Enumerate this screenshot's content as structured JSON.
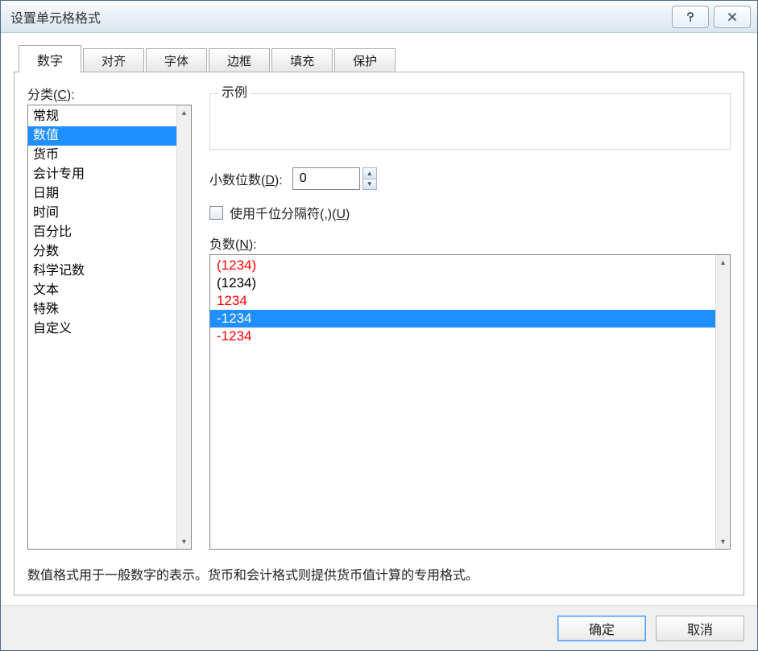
{
  "window": {
    "title": "设置单元格格式"
  },
  "tabs": [
    {
      "label": "数字",
      "active": true
    },
    {
      "label": "对齐",
      "active": false
    },
    {
      "label": "字体",
      "active": false
    },
    {
      "label": "边框",
      "active": false
    },
    {
      "label": "填充",
      "active": false
    },
    {
      "label": "保护",
      "active": false
    }
  ],
  "category": {
    "label_prefix": "分类(",
    "label_hotkey": "C",
    "label_suffix": "):",
    "items": [
      {
        "label": "常规",
        "selected": false
      },
      {
        "label": "数值",
        "selected": true
      },
      {
        "label": "货币",
        "selected": false
      },
      {
        "label": "会计专用",
        "selected": false
      },
      {
        "label": "日期",
        "selected": false
      },
      {
        "label": "时间",
        "selected": false
      },
      {
        "label": "百分比",
        "selected": false
      },
      {
        "label": "分数",
        "selected": false
      },
      {
        "label": "科学记数",
        "selected": false
      },
      {
        "label": "文本",
        "selected": false
      },
      {
        "label": "特殊",
        "selected": false
      },
      {
        "label": "自定义",
        "selected": false
      }
    ]
  },
  "example": {
    "legend": "示例",
    "value": ""
  },
  "decimal": {
    "label_prefix": "小数位数(",
    "label_hotkey": "D",
    "label_suffix": "):",
    "value": "0"
  },
  "thousands": {
    "label_prefix": "使用千位分隔符(,)(",
    "label_hotkey": "U",
    "label_suffix": ")",
    "checked": false
  },
  "negative": {
    "label_prefix": "负数(",
    "label_hotkey": "N",
    "label_suffix": "):",
    "items": [
      {
        "text": "(1234)",
        "color": "red",
        "selected": false
      },
      {
        "text": "(1234)",
        "color": "black",
        "selected": false
      },
      {
        "text": "1234",
        "color": "red",
        "selected": false
      },
      {
        "text": "-1234",
        "color": "black",
        "selected": true
      },
      {
        "text": "-1234",
        "color": "red",
        "selected": false
      }
    ]
  },
  "description": "数值格式用于一般数字的表示。货币和会计格式则提供货币值计算的专用格式。",
  "buttons": {
    "ok": "确定",
    "cancel": "取消"
  }
}
